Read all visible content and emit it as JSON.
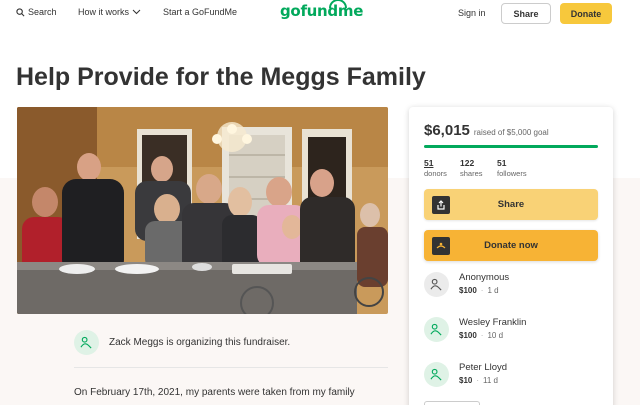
{
  "header": {
    "search_label": "Search",
    "how_label": "How it works",
    "start_label": "Start a GoFundMe",
    "logo_text": "gofundme",
    "signin_label": "Sign in",
    "share_label": "Share",
    "donate_label": "Donate"
  },
  "page": {
    "title": "Help Provide for the Meggs Family",
    "organizer_text": "Zack Meggs is organizing this fundraiser.",
    "story_first_line": "On February 17th, 2021, my parents were taken from my family"
  },
  "card": {
    "amount_raised": "$6,015",
    "goal_text": "raised of $5,000 goal",
    "progress_fraction": 1.0,
    "stats": [
      {
        "num": "51",
        "label": "donors"
      },
      {
        "num": "122",
        "label": "shares"
      },
      {
        "num": "51",
        "label": "followers"
      }
    ],
    "share_label": "Share",
    "donate_label": "Donate now",
    "donors": [
      {
        "name": "Anonymous",
        "amount": "$100",
        "time": "1 d"
      },
      {
        "name": "Wesley Franklin",
        "amount": "$100",
        "time": "10 d"
      },
      {
        "name": "Peter Lloyd",
        "amount": "$10",
        "time": "11 d"
      }
    ]
  },
  "colors": {
    "brand_green": "#02a95c",
    "donate_yellow": "#f7b335",
    "share_yellow": "#f9d276"
  }
}
